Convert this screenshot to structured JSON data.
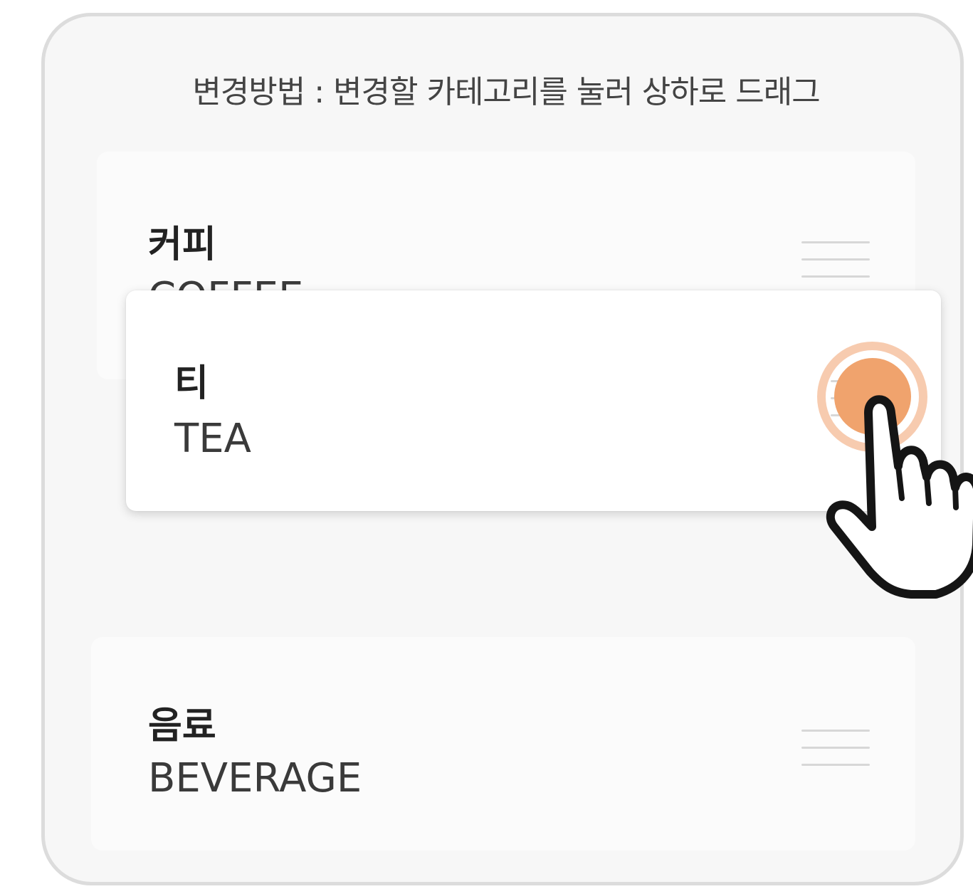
{
  "instruction": "변경방법 : 변경할 카테고리를 눌러 상하로 드래그",
  "categories": [
    {
      "name": "커피",
      "sub": "COFFEE"
    },
    {
      "name": "티",
      "sub": "TEA"
    },
    {
      "name": "음료",
      "sub": "BEVERAGE"
    }
  ],
  "dragged_item_index": 1,
  "colors": {
    "touch_accent": "#f0a36d",
    "panel_border": "#dcdcdc",
    "panel_background": "#f7f7f7"
  },
  "icons": {
    "handle": "drag-handle-icon",
    "pointer": "hand-pointer-icon"
  }
}
